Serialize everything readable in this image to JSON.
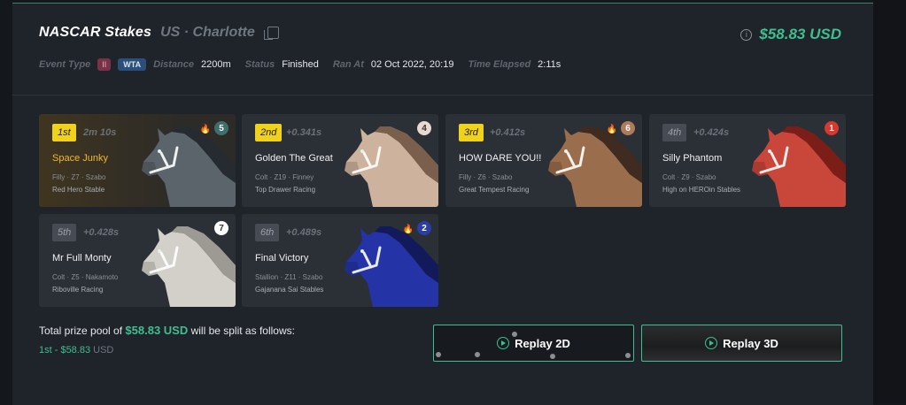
{
  "event": {
    "title": "NASCAR Stakes",
    "location": "US · Charlotte",
    "prize": "$58.83 USD"
  },
  "meta": {
    "event_type_label": "Event Type",
    "class_badge": "II",
    "type_badge": "WTA",
    "distance_label": "Distance",
    "distance": "2200m",
    "status_label": "Status",
    "status": "Finished",
    "ran_at_label": "Ran At",
    "ran_at": "02 Oct 2022, 20:19",
    "elapsed_label": "Time Elapsed",
    "elapsed": "2:11s"
  },
  "results": [
    {
      "place": "1st",
      "time": "2m 10s",
      "name": "Space Junky",
      "info": "Filly · Z7 · Szabo",
      "stable": "Red Hero Stable",
      "gate": "5",
      "gate_color": "#3f6f6d",
      "horse_color": "#5b646b",
      "mane": "#262b31"
    },
    {
      "place": "2nd",
      "time": "+0.341s",
      "name": "Golden The Great",
      "info": "Colt · Z19 · Finney",
      "stable": "Top Drawer Racing",
      "gate": "4",
      "gate_color": "#e9d9cf",
      "horse_color": "#cdb39d",
      "mane": "#7a5f4d"
    },
    {
      "place": "3rd",
      "time": "+0.412s",
      "name": "HOW DARE YOU!!",
      "info": "Filly · Z6 · Szabo",
      "stable": "Great Tempest Racing",
      "gate": "6",
      "gate_color": "#b07b5b",
      "horse_color": "#9a6d4c",
      "mane": "#3f2b1f"
    },
    {
      "place": "4th",
      "time": "+0.424s",
      "name": "Silly Phantom",
      "info": "Colt · Z9 · Szabo",
      "stable": "High on HEROin Stables",
      "gate": "1",
      "gate_color": "#d63a2f",
      "horse_color": "#c9463a",
      "mane": "#7b1e17"
    },
    {
      "place": "5th",
      "time": "+0.428s",
      "name": "Mr Full Monty",
      "info": "Colt · Z5 · Nakamoto",
      "stable": "Riboville Racing",
      "gate": "7",
      "gate_color": "#ffffff",
      "horse_color": "#d2d0c8",
      "mane": "#9c9a92"
    },
    {
      "place": "6th",
      "time": "+0.489s",
      "name": "Final Victory",
      "info": "Stallion · Z11 · Szabo",
      "stable": "Gajanana Sai Stables",
      "gate": "2",
      "gate_color": "#2b3da8",
      "horse_color": "#2434a6",
      "mane": "#121a5c"
    }
  ],
  "pool": {
    "prefix": "Total prize pool of",
    "amount": "$58.83 USD",
    "suffix": "will be split as follows:",
    "split_label": "1st - $58.83",
    "split_unit": "USD"
  },
  "replay": {
    "replay_2d": "Replay 2D",
    "replay_3d": "Replay 3D"
  },
  "colors": {
    "accent": "#3fbf8f",
    "gold": "#f1d21b"
  }
}
